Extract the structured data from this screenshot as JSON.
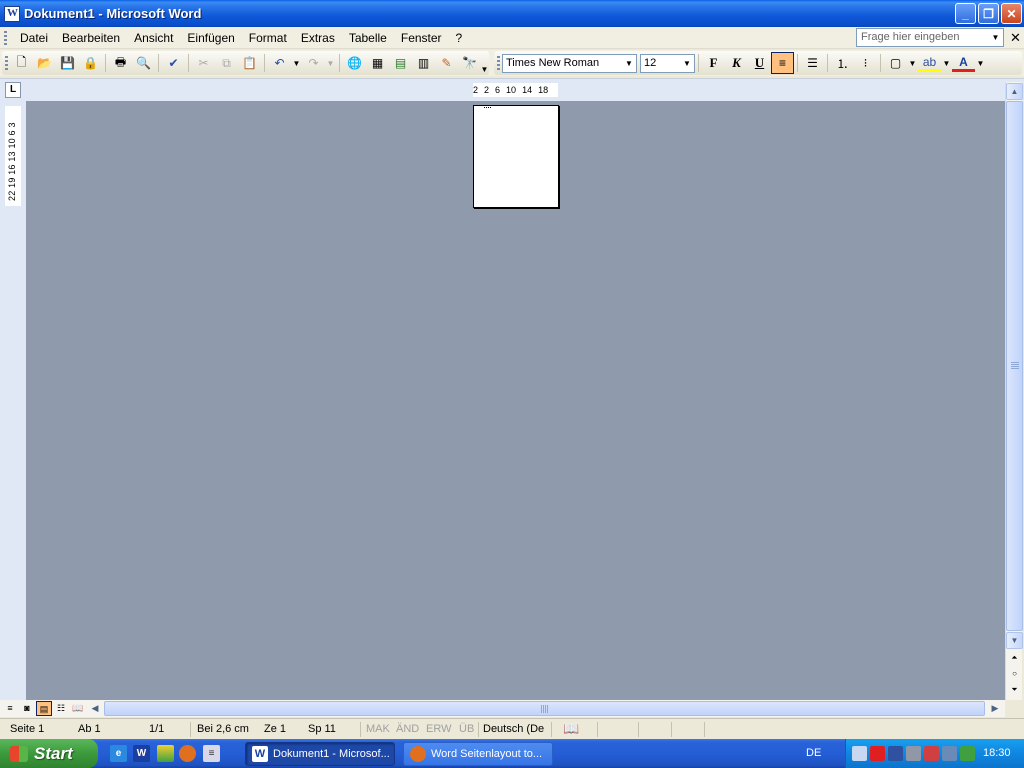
{
  "window": {
    "title": "Dokument1 - Microsoft Word"
  },
  "menu": {
    "items": [
      "Datei",
      "Bearbeiten",
      "Ansicht",
      "Einfügen",
      "Format",
      "Extras",
      "Tabelle",
      "Fenster",
      "?"
    ],
    "ask_placeholder": "Frage hier eingeben"
  },
  "toolbar": {
    "font_name": "Times New Roman",
    "font_size": "12",
    "bold_label": "F",
    "italic_label": "K",
    "underline_label": "U"
  },
  "ruler": {
    "h_ticks": [
      "2",
      "2",
      "6",
      "10",
      "14",
      "18"
    ],
    "v_ticks": "22 19 16 13 10  6  3"
  },
  "statusbar": {
    "page": "Seite 1",
    "section": "Ab 1",
    "pages": "1/1",
    "position": "Bei 2,6 cm",
    "line": "Ze 1",
    "column": "Sp 11",
    "mak": "MAK",
    "and": "ÄND",
    "erw": "ERW",
    "ub": "ÜB",
    "language": "Deutsch (De"
  },
  "taskbar": {
    "start_label": "Start",
    "tasks": [
      {
        "label": "Dokument1 - Microsof...",
        "active": true
      },
      {
        "label": "Word Seitenlayout to...",
        "active": false
      }
    ],
    "language": "DE",
    "clock": "18:30"
  },
  "colors": {
    "titlebar": "#0A4FCC",
    "workspace": "#8F9AAD",
    "taskbar": "#245ED6",
    "start_green": "#3C9A3C"
  }
}
